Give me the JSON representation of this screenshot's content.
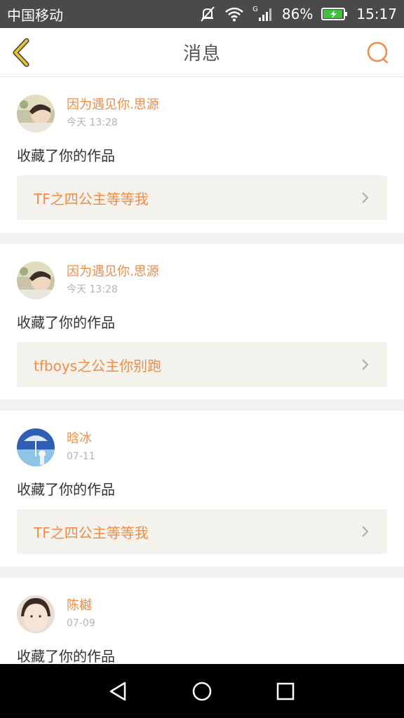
{
  "status_bar": {
    "carrier": "中国移动",
    "signal_type": "G",
    "battery": "86%",
    "time": "15:17"
  },
  "header": {
    "title": "消息"
  },
  "messages": [
    {
      "user": "因为遇见你.思源",
      "time": "今天 13:28",
      "action": "收藏了你的作品",
      "work": "TF之四公主等等我"
    },
    {
      "user": "因为遇见你.思源",
      "time": "今天 13:28",
      "action": "收藏了你的作品",
      "work": "tfboys之公主你别跑"
    },
    {
      "user": "晗冰",
      "time": "07-11",
      "action": "收藏了你的作品",
      "work": "TF之四公主等等我"
    },
    {
      "user": "陈樾",
      "time": "07-09",
      "action": "收藏了你的作品",
      "work": ""
    }
  ],
  "colors": {
    "accent": "#f08c4a",
    "back_icon": "#e6c22e",
    "card_link_bg": "#f3f2ec"
  }
}
